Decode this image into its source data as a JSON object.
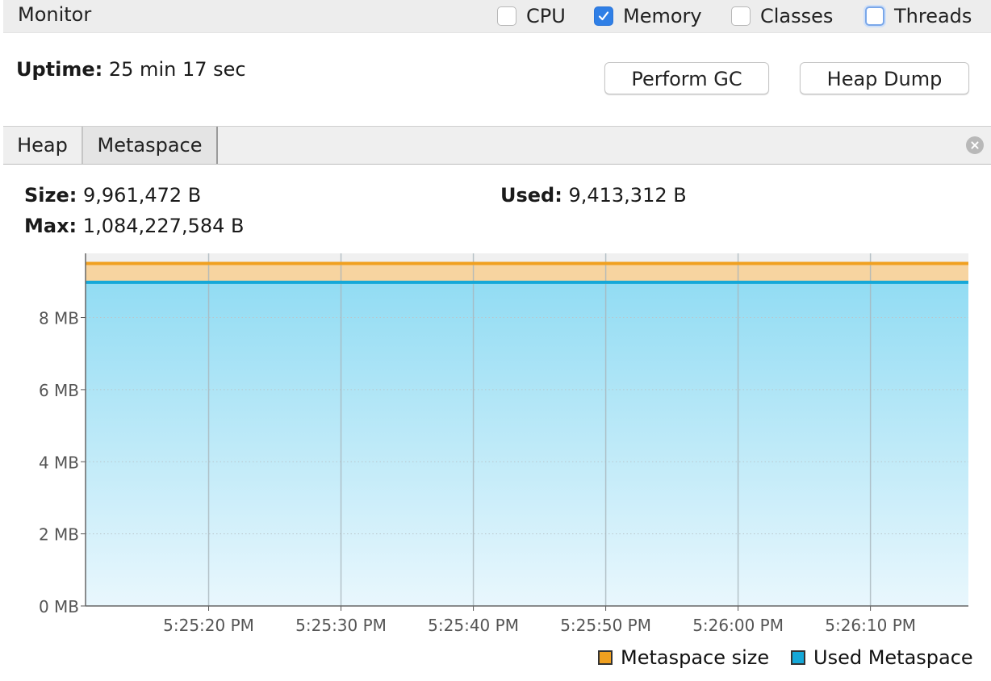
{
  "header": {
    "title": "Monitor",
    "checkboxes": [
      {
        "label": "CPU",
        "checked": false
      },
      {
        "label": "Memory",
        "checked": true
      },
      {
        "label": "Classes",
        "checked": false
      },
      {
        "label": "Threads",
        "checked": false
      }
    ]
  },
  "uptime": {
    "label": "Uptime:",
    "value": "25 min 17 sec"
  },
  "buttons": {
    "perform_gc": "Perform GC",
    "heap_dump": "Heap Dump"
  },
  "tabs": [
    {
      "label": "Heap",
      "selected": false
    },
    {
      "label": "Metaspace",
      "selected": true
    }
  ],
  "stats": {
    "size_label": "Size:",
    "size_value": "9,961,472 B",
    "used_label": "Used:",
    "used_value": "9,413,312 B",
    "max_label": "Max:",
    "max_value": "1,084,227,584 B"
  },
  "colors": {
    "metaspace_size": "#f0a020",
    "used_metaspace": "#15a8d8",
    "checkbox_accent": "#2f7fe6"
  },
  "icons": {
    "close": "close-icon",
    "check": "check-icon"
  },
  "chart_data": {
    "type": "area",
    "title": "",
    "xlabel": "",
    "ylabel": "",
    "y_unit": "MB",
    "ylim": [
      0,
      9.78
    ],
    "y_ticks": [
      0,
      2,
      4,
      6,
      8
    ],
    "y_tick_labels": [
      "0 MB",
      "2 MB",
      "4 MB",
      "6 MB",
      "8 MB"
    ],
    "x_ticks": [
      "5:25:20 PM",
      "5:25:30 PM",
      "5:25:40 PM",
      "5:25:50 PM",
      "5:26:00 PM",
      "5:26:10 PM"
    ],
    "xlim": [
      "5:25:10.7 PM",
      "5:26:17.4 PM"
    ],
    "grid": true,
    "legend_position": "bottom-right",
    "series": [
      {
        "name": "Metaspace size",
        "values_bytes": [
          9961472,
          9961472
        ],
        "x": [
          "5:25:10.7 PM",
          "5:26:17.4 PM"
        ],
        "color": "#f0a020"
      },
      {
        "name": "Used Metaspace",
        "values_bytes": [
          9413312,
          9413312
        ],
        "x": [
          "5:25:10.7 PM",
          "5:26:17.4 PM"
        ],
        "color": "#15a8d8"
      }
    ]
  }
}
